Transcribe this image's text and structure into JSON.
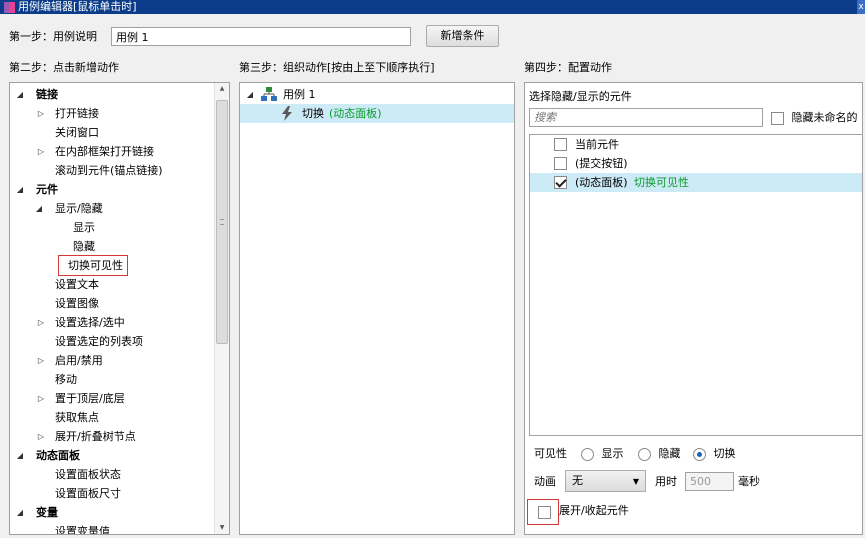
{
  "window": {
    "title": "用例编辑器[鼠标单击时]",
    "close_glyph": "x"
  },
  "step1": {
    "label": "第一步：用例说明",
    "value": "用例 1",
    "add_condition": "新增条件"
  },
  "step2": {
    "heading": "第二步：点击新增动作",
    "tree": [
      {
        "label": "链接"
      },
      {
        "label": "打开链接"
      },
      {
        "label": "关闭窗口"
      },
      {
        "label": "在内部框架打开链接"
      },
      {
        "label": "滚动到元件(锚点链接)"
      },
      {
        "label": "元件"
      },
      {
        "label": "显示/隐藏"
      },
      {
        "label": "显示"
      },
      {
        "label": "隐藏"
      },
      {
        "label": "切换可见性"
      },
      {
        "label": "设置文本"
      },
      {
        "label": "设置图像"
      },
      {
        "label": "设置选择/选中"
      },
      {
        "label": "设置选定的列表项"
      },
      {
        "label": "启用/禁用"
      },
      {
        "label": "移动"
      },
      {
        "label": "置于顶层/底层"
      },
      {
        "label": "获取焦点"
      },
      {
        "label": "展开/折叠树节点"
      },
      {
        "label": "动态面板"
      },
      {
        "label": "设置面板状态"
      },
      {
        "label": "设置面板尺寸"
      },
      {
        "label": "变量"
      },
      {
        "label": "设置变量值"
      }
    ]
  },
  "step3": {
    "heading": "第三步：组织动作[按由上至下顺序执行]",
    "case_label": "用例 1",
    "action_label": "切换",
    "action_target": "(动态面板)"
  },
  "step4": {
    "heading": "第四步：配置动作",
    "select_label": "选择隐藏/显示的元件",
    "search_placeholder": "搜索",
    "hide_unnamed_label": "隐藏未命名的",
    "widgets": [
      {
        "label": "当前元件",
        "extra": "",
        "checked": false
      },
      {
        "label": "(提交按钮)",
        "extra": "",
        "checked": false
      },
      {
        "label": "(动态面板)",
        "extra": "切换可见性",
        "checked": true
      }
    ],
    "visibility_label": "可见性",
    "radio_show": "显示",
    "radio_hide": "隐藏",
    "radio_toggle": "切换",
    "animation_label": "动画",
    "animation_value": "无",
    "duration_label": "用时",
    "duration_value": "500",
    "ms_label": "毫秒",
    "expand_collapse_label": "展开/收起元件"
  }
}
